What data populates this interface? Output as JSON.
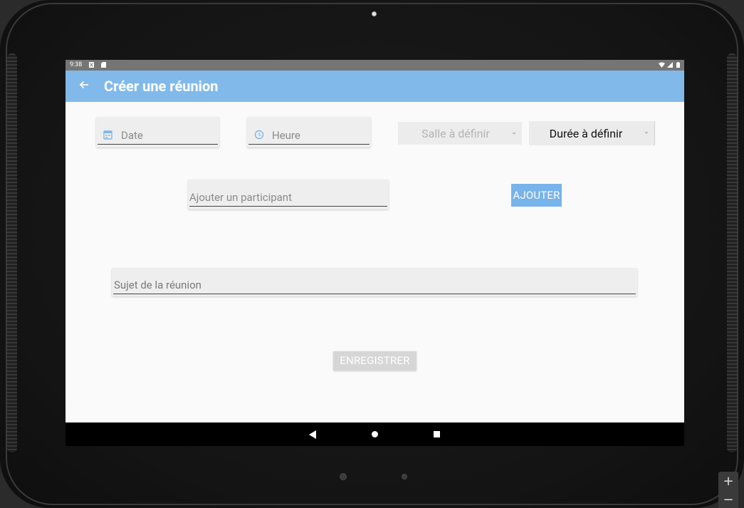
{
  "status_bar": {
    "time": "9:38"
  },
  "app_bar": {
    "title": "Créer une réunion"
  },
  "form": {
    "date_placeholder": "Date",
    "time_placeholder": "Heure",
    "room_spinner": "Salle à définir",
    "duration_spinner": "Durée à définir",
    "participant_placeholder": "Ajouter un participant",
    "add_button": "AJOUTER",
    "subject_placeholder": "Sujet de la réunion",
    "save_button": "ENREGISTRER"
  },
  "colors": {
    "app_bar": "#81b9ea",
    "add_button": "#78b3ea",
    "save_button_disabled": "#d6d6d6",
    "icon_blue": "#7fb6e9"
  },
  "icons": {
    "back": "arrow-back-icon",
    "date": "calendar-icon",
    "time": "clock-icon",
    "nav_back": "triangle-back-icon",
    "nav_home": "circle-home-icon",
    "nav_recent": "square-recents-icon"
  },
  "emulator": {
    "zoom_in": "+",
    "zoom_out": "−"
  }
}
